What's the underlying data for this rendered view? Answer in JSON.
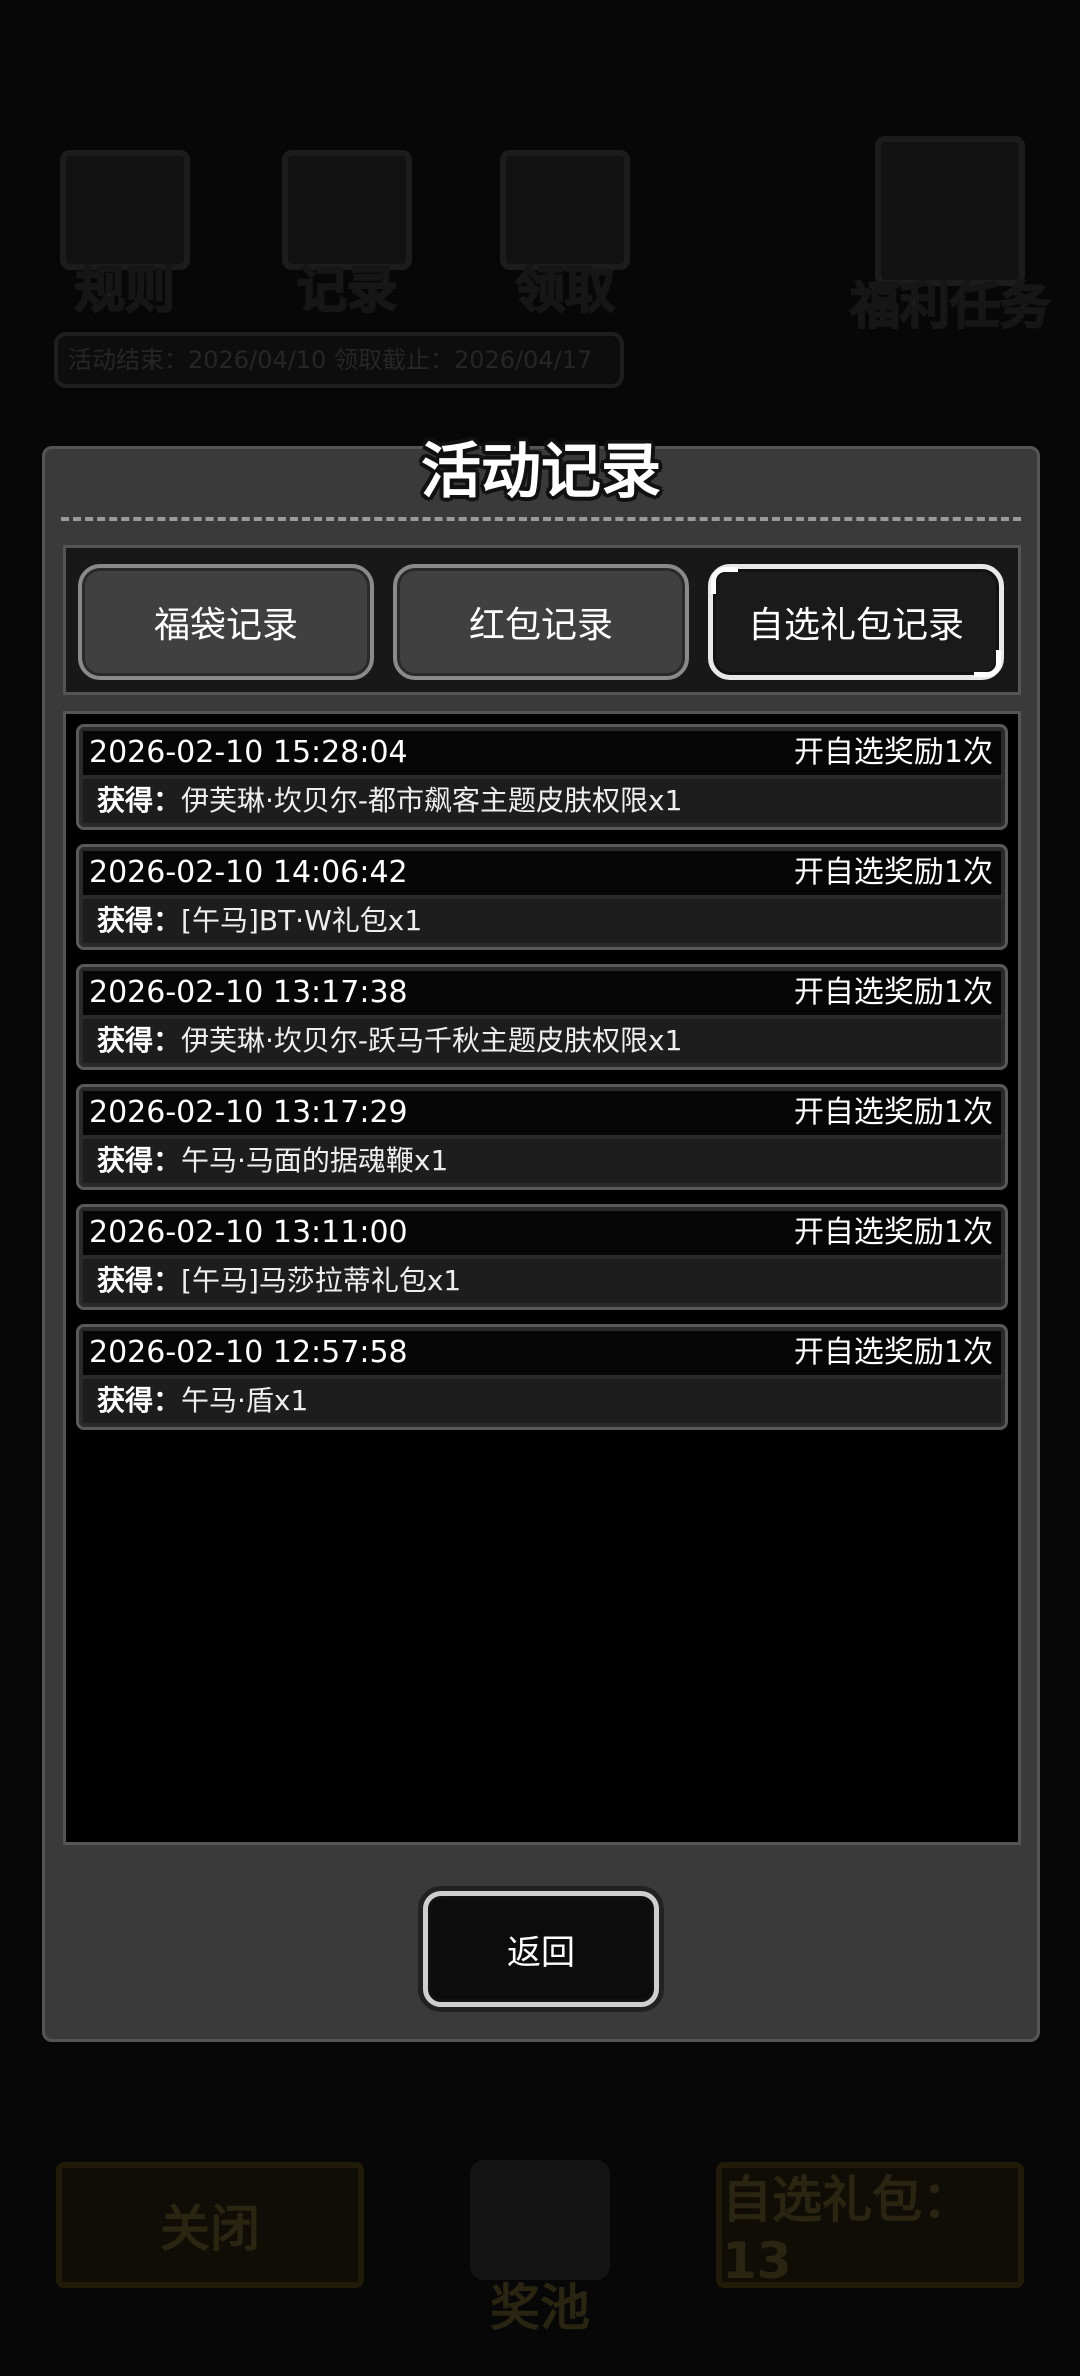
{
  "background": {
    "icons": [
      {
        "label": "规则",
        "icon": "rules-book-icon"
      },
      {
        "label": "记录",
        "icon": "record-clipboard-icon"
      },
      {
        "label": "领取",
        "icon": "claim-chest-icon"
      },
      {
        "label": "福利任务",
        "icon": "welfare-task-icon"
      }
    ],
    "date_text": "活动结束：2026/04/10  领取截止：2026/04/17",
    "close_label": "关闭",
    "pool_label": "奖池",
    "select_gift_label": "自选礼包：13"
  },
  "modal": {
    "title": "活动记录",
    "tabs": [
      {
        "label": "福袋记录",
        "active": false
      },
      {
        "label": "红包记录",
        "active": false
      },
      {
        "label": "自选礼包记录",
        "active": true
      }
    ],
    "gain_prefix": "获得：",
    "records": [
      {
        "time": "2026-02-10 15:28:04",
        "type": "开自选奖励1次",
        "item": "伊芙琳·坎贝尔-都市飙客主题皮肤权限x1"
      },
      {
        "time": "2026-02-10 14:06:42",
        "type": "开自选奖励1次",
        "item": "[午马]BT·W礼包x1"
      },
      {
        "time": "2026-02-10 13:17:38",
        "type": "开自选奖励1次",
        "item": "伊芙琳·坎贝尔-跃马千秋主题皮肤权限x1"
      },
      {
        "time": "2026-02-10 13:17:29",
        "type": "开自选奖励1次",
        "item": "午马·马面的据魂鞭x1"
      },
      {
        "time": "2026-02-10 13:11:00",
        "type": "开自选奖励1次",
        "item": "[午马]马莎拉蒂礼包x1"
      },
      {
        "time": "2026-02-10 12:57:58",
        "type": "开自选奖励1次",
        "item": "午马·盾x1"
      }
    ],
    "back_label": "返回"
  }
}
